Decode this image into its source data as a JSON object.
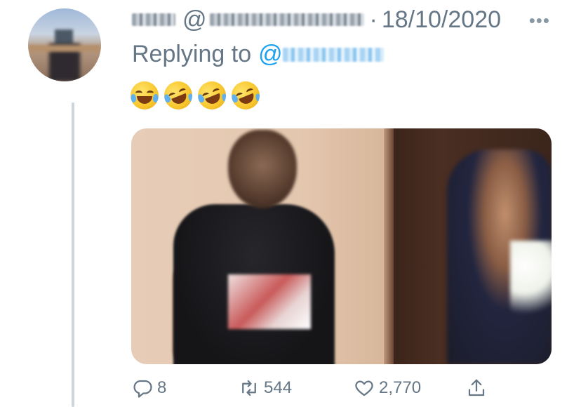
{
  "tweet": {
    "display_name": "",
    "handle_prefix": "@",
    "separator": "·",
    "date": "18/10/2020",
    "more_label": "•••",
    "replying_prefix": "Replying to",
    "reply_to_prefix": "@",
    "text_emojis": [
      "😂",
      "🤣",
      "🤣",
      "🤣"
    ]
  },
  "actions": {
    "reply_count": "8",
    "retweet_count": "544",
    "like_count": "2,770",
    "share_count": ""
  },
  "colors": {
    "link": "#1da1f2",
    "secondary_text": "#657786",
    "thread_line": "#ced5dc"
  },
  "icons": [
    "reply-icon",
    "retweet-icon",
    "like-icon",
    "share-icon",
    "more-icon"
  ]
}
